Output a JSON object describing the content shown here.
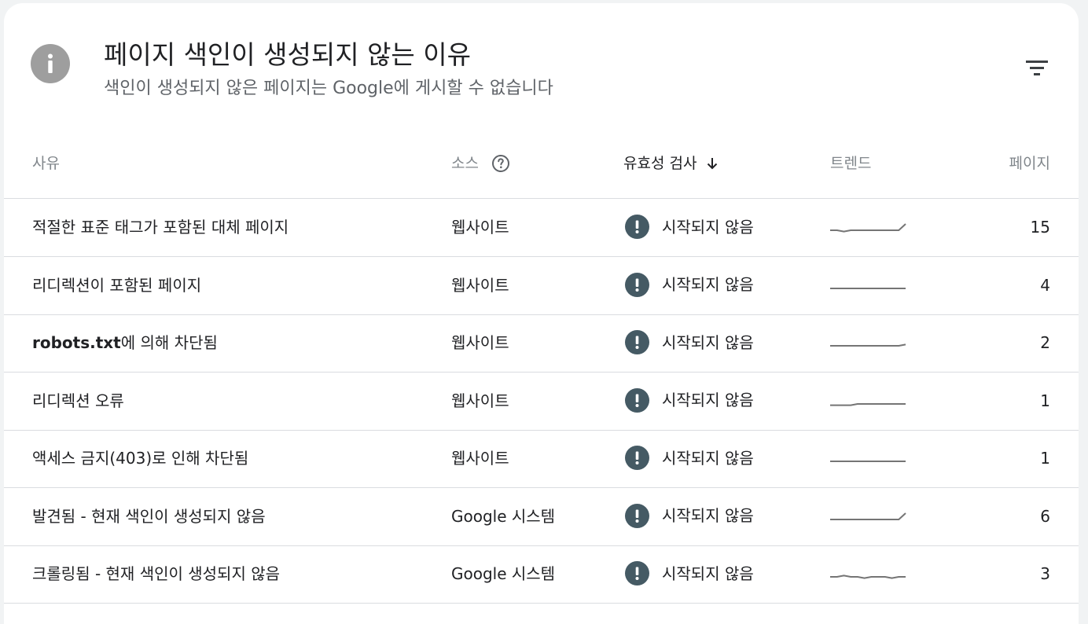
{
  "header": {
    "title": "페이지 색인이 생성되지 않는 이유",
    "subtitle": "색인이 생성되지 않은 페이지는 Google에 게시할 수 없습니다"
  },
  "columns": {
    "reason": "사유",
    "source": "소스",
    "validation": "유효성 검사",
    "trend": "트렌드",
    "pages": "페이지"
  },
  "colors": {
    "warning": "#455a64",
    "info": "#9e9e9e",
    "sparkline": "#757575"
  },
  "rows": [
    {
      "reason": "적절한 표준 태그가 포함된 대체 페이지",
      "source": "웹사이트",
      "validation": "시작되지 않음",
      "pages": "15",
      "trend": [
        3,
        3,
        2,
        3,
        3,
        3,
        3,
        3,
        3,
        3,
        3,
        8
      ]
    },
    {
      "reason": "리디렉션이 포함된 페이지",
      "source": "웹사이트",
      "validation": "시작되지 않음",
      "pages": "4",
      "trend": [
        3,
        3,
        3,
        3,
        3,
        3,
        3,
        3,
        3,
        3,
        3,
        3
      ]
    },
    {
      "reason_pre": "robots.txt",
      "reason": "에 의해 차단됨",
      "source": "웹사이트",
      "validation": "시작되지 않음",
      "pages": "2",
      "trend": [
        3,
        3,
        3,
        3,
        3,
        3,
        3,
        3,
        3,
        3,
        3,
        4
      ]
    },
    {
      "reason": "리디렉션 오류",
      "source": "웹사이트",
      "validation": "시작되지 않음",
      "pages": "1",
      "trend": [
        2,
        2,
        2,
        2,
        3,
        3,
        3,
        3,
        3,
        3,
        3,
        3
      ]
    },
    {
      "reason_pre": "",
      "reason": "액세스 금지(403)로 인해 차단됨",
      "source": "웹사이트",
      "validation": "시작되지 않음",
      "pages": "1",
      "trend": [
        3,
        3,
        3,
        3,
        3,
        3,
        3,
        3,
        3,
        3,
        3,
        3
      ]
    },
    {
      "reason": "발견됨 - 현재 색인이 생성되지 않음",
      "source": "Google 시스템",
      "validation": "시작되지 않음",
      "pages": "6",
      "trend": [
        3,
        3,
        3,
        3,
        3,
        3,
        3,
        3,
        3,
        3,
        3,
        8
      ]
    },
    {
      "reason": "크롤링됨 - 현재 색인이 생성되지 않음",
      "source": "Google 시스템",
      "validation": "시작되지 않음",
      "pages": "3",
      "trend": [
        3,
        3,
        4,
        3,
        3,
        2,
        3,
        3,
        3,
        2,
        3,
        3
      ]
    }
  ]
}
